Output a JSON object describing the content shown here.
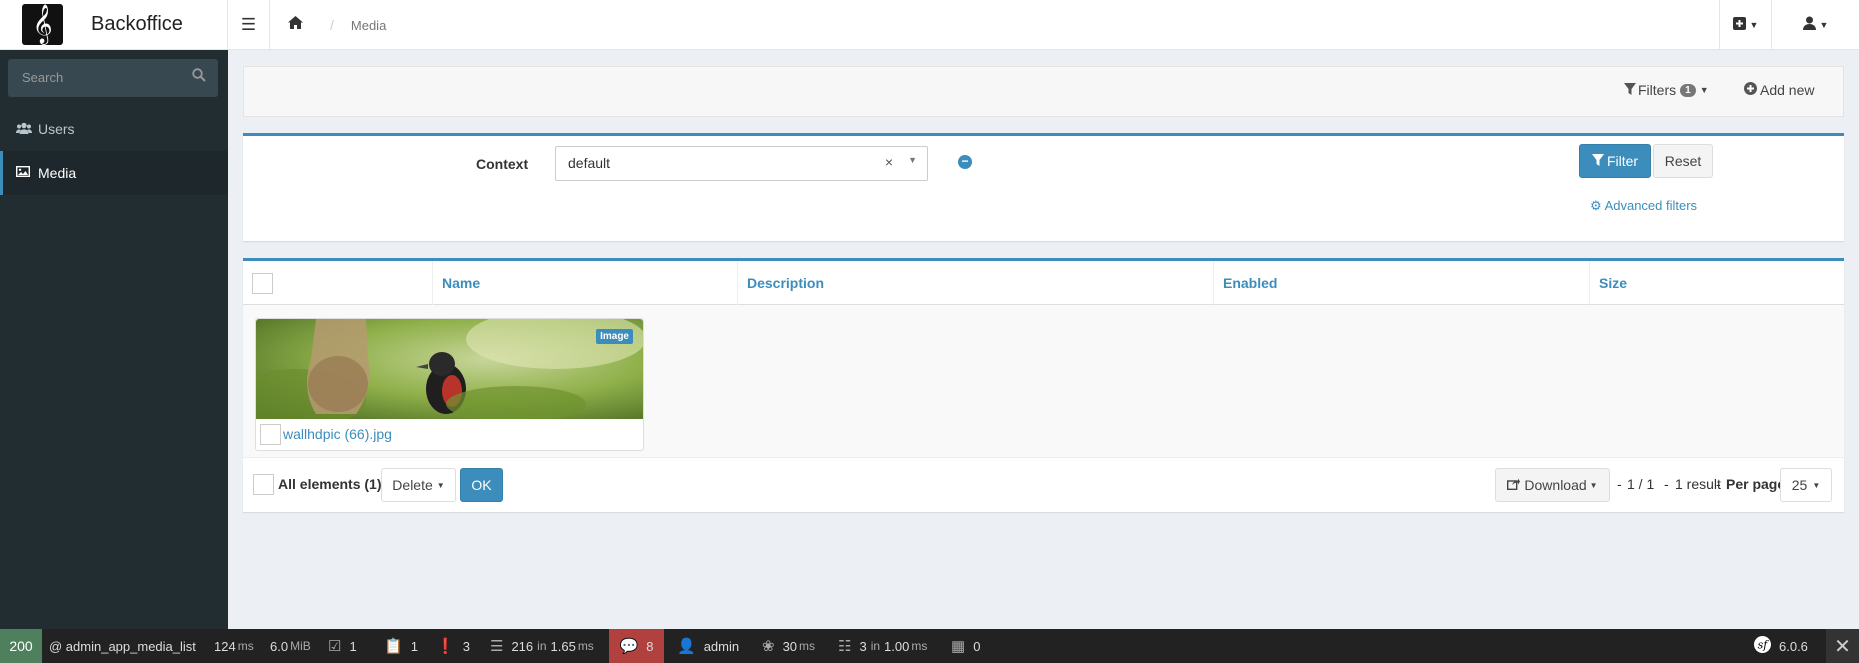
{
  "app": {
    "name": "Backoffice"
  },
  "breadcrumb": {
    "current": "Media"
  },
  "sidebar": {
    "search_placeholder": "Search",
    "items": [
      {
        "label": "Users"
      },
      {
        "label": "Media"
      }
    ]
  },
  "actions": {
    "filters_label": "Filters",
    "filters_count": "1",
    "add_new_label": "Add new"
  },
  "filter_form": {
    "context_label": "Context",
    "context_value": "default",
    "filter_button": "Filter",
    "reset_button": "Reset",
    "advanced_filters": "Advanced filters"
  },
  "table": {
    "columns": [
      "Name",
      "Description",
      "Enabled",
      "Size"
    ],
    "items": [
      {
        "filename": "wallhdpic (66).jpg",
        "badge": "Image"
      }
    ]
  },
  "batch": {
    "all_elements_label": "All elements (1)",
    "action_selected": "Delete",
    "ok_button": "OK",
    "download_label": "Download",
    "pages": "1 / 1",
    "results": "1 result",
    "per_page_label": "Per page",
    "per_page_value": "25"
  },
  "toolbar": {
    "status": "200",
    "route": "@ admin_app_media_list",
    "time_value": "124",
    "time_unit": "ms",
    "memory_value": "6.0",
    "memory_unit": "MiB",
    "forms": "1",
    "validator": "1",
    "logs": "3",
    "cache_count": "216",
    "cache_in": "in",
    "cache_time": "1.65",
    "cache_unit": "ms",
    "translation_count": "8",
    "user": "admin",
    "twig_time": "30",
    "twig_unit": "ms",
    "db_count": "3",
    "db_in": "in",
    "db_time": "1.00",
    "db_unit": "ms",
    "sonata_count": "0",
    "symfony_version": "6.0.6"
  },
  "colors": {
    "primary": "#3c8dbc",
    "sidebar": "#222d32",
    "toolbar": "#222",
    "status_ok": "#4f805d",
    "translation_bg": "#b0413e"
  }
}
